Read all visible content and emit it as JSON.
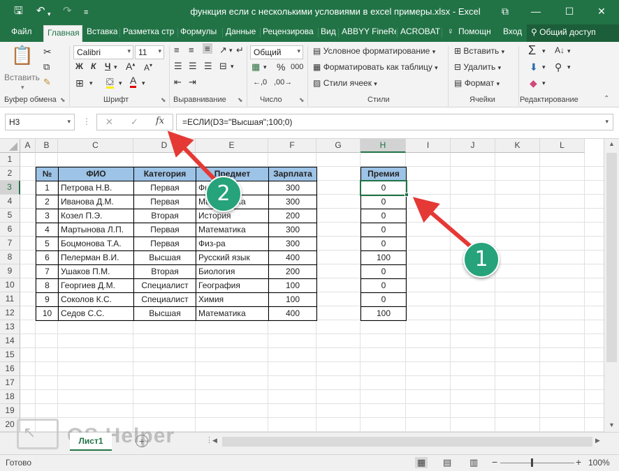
{
  "window": {
    "title": "функция если с несколькими условиями в excel примеры.xlsx - Excel",
    "minimize": "—",
    "maximize": "☐",
    "close": "✕",
    "restore": "⧉"
  },
  "tabs": [
    "Файл",
    "Главная",
    "Вставка",
    "Разметка стр",
    "Формулы",
    "Данные",
    "Рецензирова",
    "Вид",
    "ABBYY FineRe",
    "ACROBAT",
    "Помощн",
    "Вход"
  ],
  "share_label": "Общий доступ",
  "ribbon": {
    "paste_label": "Вставить",
    "font_name": "Calibri",
    "font_size": "11",
    "bold": "Ж",
    "italic": "К",
    "underline": "Ч",
    "number_format": "Общий",
    "percent": "%",
    "thousands": "000",
    "cond_format": "Условное форматирование",
    "format_table": "Форматировать как таблицу",
    "cell_styles": "Стили ячеек",
    "insert": "Вставить",
    "delete": "Удалить",
    "format": "Формат",
    "groups": [
      "Буфер обмена",
      "Шрифт",
      "Выравнивание",
      "Число",
      "Стили",
      "Ячейки",
      "Редактирование"
    ]
  },
  "formula_bar": {
    "name_box": "H3",
    "formula": "=ЕСЛИ(D3=\"Высшая\";100;0)",
    "fx": "fx"
  },
  "columns": [
    "A",
    "B",
    "C",
    "D",
    "E",
    "F",
    "G",
    "H",
    "I",
    "J",
    "K",
    "L"
  ],
  "rows": [
    "1",
    "2",
    "3",
    "4",
    "5",
    "6",
    "7",
    "8",
    "9",
    "10",
    "11",
    "12",
    "13",
    "14",
    "15",
    "16",
    "17",
    "18",
    "19",
    "20"
  ],
  "table": {
    "headers": [
      "№",
      "ФИО",
      "Категория",
      "Предмет",
      "Зарплата"
    ],
    "rows": [
      [
        "1",
        "Петрова Н.В.",
        "Первая",
        "Физ-ра",
        "300"
      ],
      [
        "2",
        "Иванова Д.М.",
        "Первая",
        "Математика",
        "300"
      ],
      [
        "3",
        "Козел П.Э.",
        "Вторая",
        "История",
        "200"
      ],
      [
        "4",
        "Мартынова Л.П.",
        "Первая",
        "Математика",
        "300"
      ],
      [
        "5",
        "Боцмонова Т.А.",
        "Первая",
        "Физ-ра",
        "300"
      ],
      [
        "6",
        "Пелерман В.И.",
        "Высшая",
        "Русский язык",
        "400"
      ],
      [
        "7",
        "Ушаков П.М.",
        "Вторая",
        "Биология",
        "200"
      ],
      [
        "8",
        "Георгиев Д.М.",
        "Специалист",
        "География",
        "100"
      ],
      [
        "9",
        "Соколов К.С.",
        "Специалист",
        "Химия",
        "100"
      ],
      [
        "10",
        "Седов С.С.",
        "Высшая",
        "Математика",
        "400"
      ]
    ]
  },
  "bonus": {
    "header": "Премия",
    "values": [
      "0",
      "0",
      "0",
      "0",
      "0",
      "100",
      "0",
      "0",
      "0",
      "100"
    ]
  },
  "sheet_tab": "Лист1",
  "watermark": "OS Helper",
  "status": {
    "ready": "Готово",
    "zoom": "100%"
  },
  "callouts": [
    "1",
    "2"
  ],
  "colors": {
    "excel_green": "#217346",
    "header_fill": "#9dc3e6",
    "arrow": "#e53935",
    "callout": "#26a37a"
  }
}
